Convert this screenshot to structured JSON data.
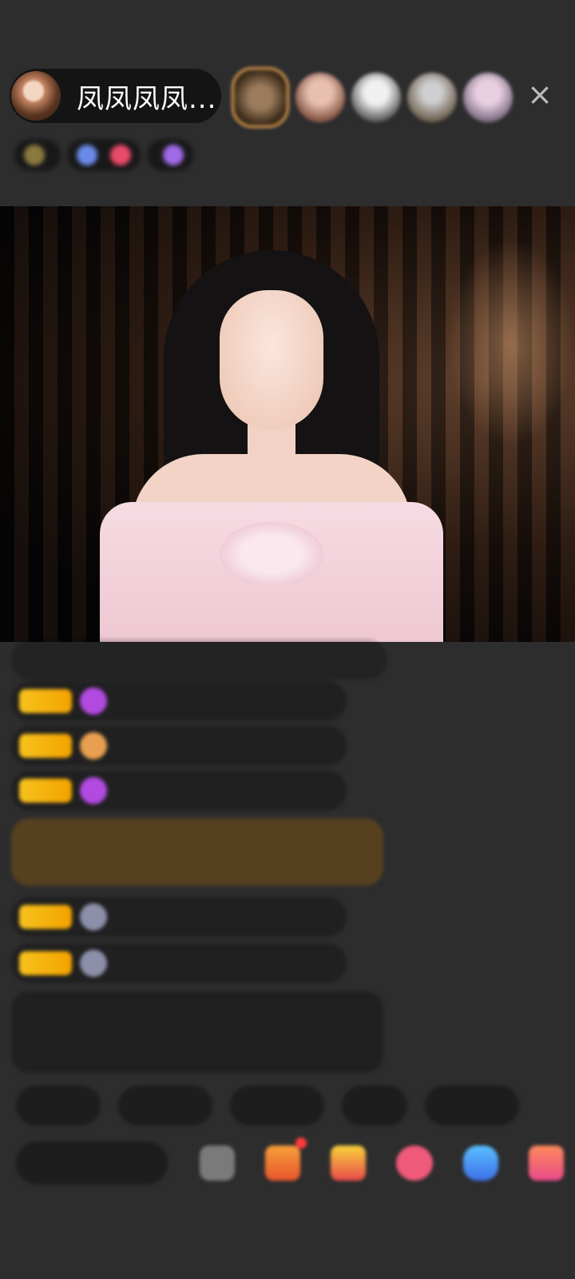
{
  "host": {
    "name": "凤凤凤凤..."
  },
  "header": {
    "close_label": "×",
    "viewers": [
      "viewer-1",
      "viewer-2",
      "viewer-3",
      "viewer-4",
      "viewer-5"
    ],
    "badges": [
      "",
      "",
      "",
      ""
    ]
  },
  "chat": {
    "messages": [
      {
        "text": ""
      },
      {
        "level": "",
        "user": "",
        "text": ""
      },
      {
        "level": "",
        "user": "",
        "text": ""
      },
      {
        "level": "",
        "user": "",
        "text": ""
      },
      {
        "text": ""
      },
      {
        "level": "",
        "user": "",
        "text": ""
      },
      {
        "level": "",
        "user": "",
        "text": ""
      },
      {
        "text": ""
      }
    ]
  },
  "quick_replies": [
    "",
    "",
    "",
    "",
    ""
  ],
  "bottom_bar": {
    "input_placeholder": "",
    "icons": [
      "emoji-icon",
      "task-icon",
      "gift-icon",
      "heart-icon",
      "game-icon",
      "more-icon"
    ]
  },
  "colors": {
    "background": "#2d2d2e",
    "level_badge": "#f7c21d",
    "system_green": "#86c96a",
    "username_purple": "#9b8fd8"
  }
}
